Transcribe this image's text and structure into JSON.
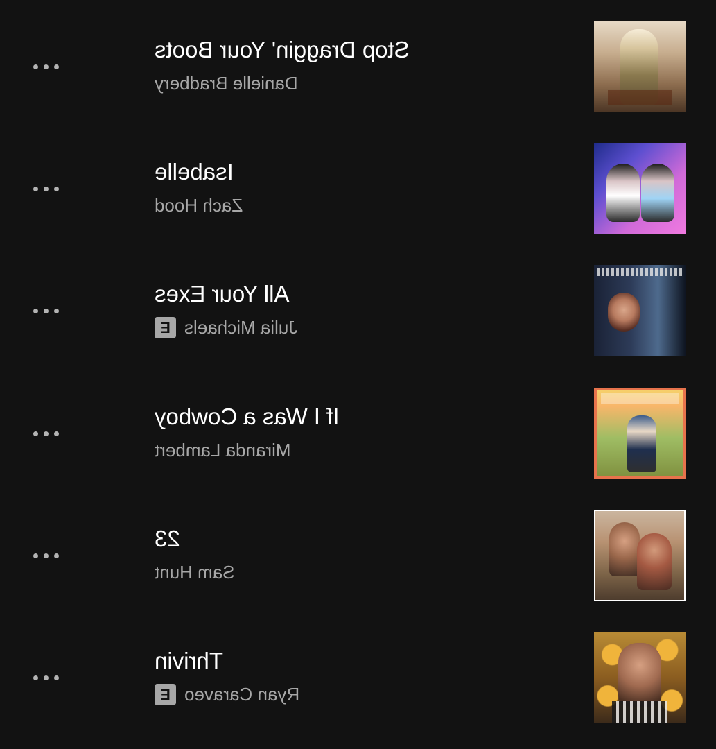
{
  "tracks": [
    {
      "title": "Stop Draggin' Your Boots",
      "artist": "Danielle Bradbery",
      "explicit": false
    },
    {
      "title": "Isabelle",
      "artist": "Zach Hood",
      "explicit": false
    },
    {
      "title": "All Your Exes",
      "artist": "Julia Michaels",
      "explicit": true
    },
    {
      "title": "If I Was a Cowboy",
      "artist": "Miranda Lambert",
      "explicit": false
    },
    {
      "title": "23",
      "artist": "Sam Hunt",
      "explicit": false
    },
    {
      "title": "Thrivin",
      "artist": "Ryan Caraveo",
      "explicit": true
    }
  ],
  "explicit_label": "E",
  "icons": {
    "more": "more-options-icon"
  },
  "colors": {
    "background": "#121212",
    "title": "#ffffff",
    "subtitle": "#a7a7a7",
    "badge": "#a7a7a7"
  }
}
